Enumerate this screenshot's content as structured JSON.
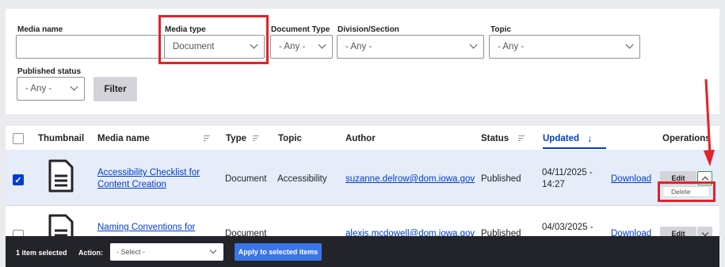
{
  "filters": {
    "media_name": {
      "label": "Media name",
      "value": ""
    },
    "media_type": {
      "label": "Media type",
      "value": "Document"
    },
    "document_type": {
      "label": "Document Type",
      "value": "- Any -"
    },
    "division": {
      "label": "Division/Section",
      "value": "- Any -"
    },
    "topic": {
      "label": "Topic",
      "value": "- Any -"
    },
    "published_status": {
      "label": "Published status",
      "value": "- Any -"
    },
    "filter_button": "Filter"
  },
  "table": {
    "headers": {
      "thumbnail": "Thumbnail",
      "media_name": "Media name",
      "type": "Type",
      "topic": "Topic",
      "author": "Author",
      "status": "Status",
      "updated": "Updated",
      "operations": "Operations"
    },
    "rows": [
      {
        "selected": true,
        "name_line1": "Accessibility Checklist for",
        "name_line2": "Content Creation",
        "type": "Document",
        "topic": "Accessibility",
        "author": "suzanne.delrow@dom.iowa.gov",
        "status": "Published",
        "updated_line1": "04/11/2025 -",
        "updated_line2": "14:27",
        "download": "Download",
        "edit": "Edit",
        "dropdown_item": "Delete"
      },
      {
        "selected": false,
        "name_line1": "Naming Conventions for",
        "type": "Document",
        "topic": "",
        "author": "alexis.mcdowell@dom.iowa.gov",
        "status": "Published",
        "updated_line1": "04/03/2025 -",
        "download": "Download",
        "edit": "Edit"
      }
    ]
  },
  "bulk": {
    "selected_count": "1 item selected",
    "action_label": "Action:",
    "action_value": "- Select -",
    "apply_button": "Apply to selected items"
  },
  "colors": {
    "accent": "#003ecc",
    "highlight": "#e1232a",
    "row_selected": "#e6ecf8",
    "bar": "#232429"
  }
}
